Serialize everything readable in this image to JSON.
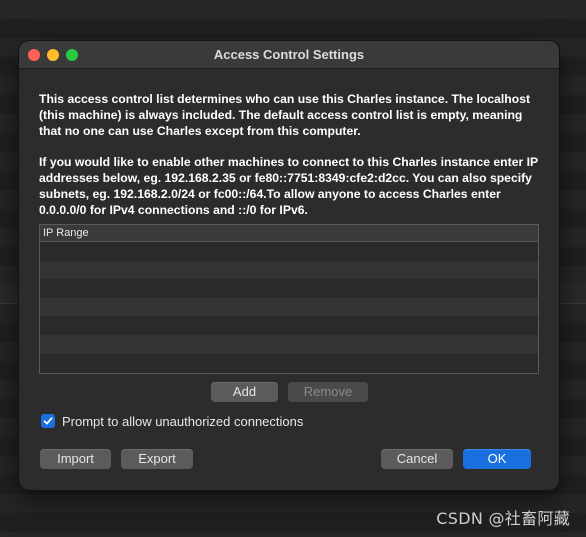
{
  "window": {
    "title": "Access Control Settings"
  },
  "description": {
    "paragraph1": "This access control list determines who can use this Charles instance. The localhost (this machine) is always included. The default access control list is empty, meaning that no one can use Charles except from this computer.",
    "paragraph2": "If you would like to enable other machines to connect to this Charles instance enter IP addresses below, eg. 192.168.2.35 or fe80::7751:8349:cfe2:d2cc. You can also specify subnets, eg. 192.168.2.0/24 or fc00::/64.To allow anyone to access Charles enter 0.0.0.0/0 for IPv4 connections and ::/0 for IPv6."
  },
  "table": {
    "column_header": "IP Range",
    "rows": []
  },
  "buttons": {
    "add": "Add",
    "remove": "Remove",
    "import": "Import",
    "export": "Export",
    "cancel": "Cancel",
    "ok": "OK"
  },
  "checkbox": {
    "label": "Prompt to allow unauthorized connections",
    "checked": true
  },
  "watermark": "CSDN @社畜阿藏",
  "colors": {
    "accent": "#1a6fde",
    "close": "#fe5f57",
    "minimize": "#febc2e",
    "maximize": "#28c840"
  }
}
